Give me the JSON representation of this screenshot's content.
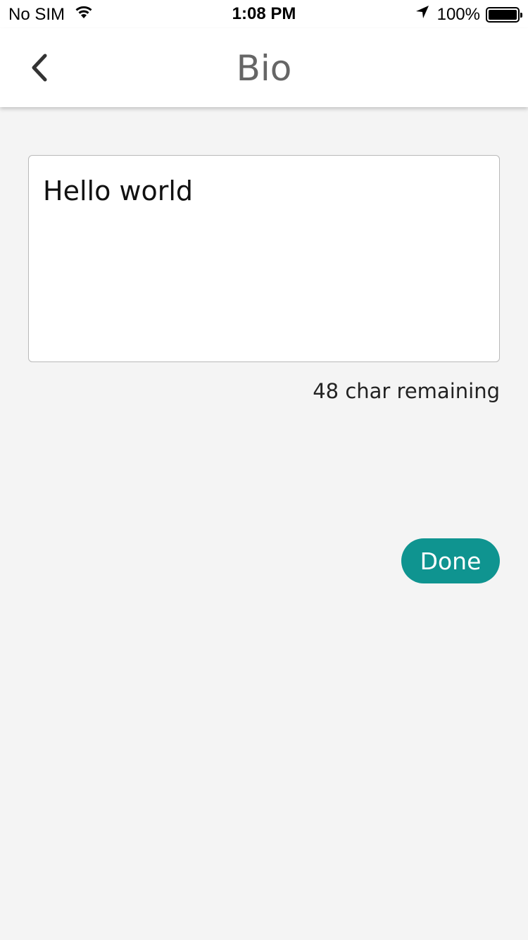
{
  "status_bar": {
    "carrier": "No SIM",
    "time": "1:08 PM",
    "battery": "100%",
    "battery_level": 1.0
  },
  "nav": {
    "title": "Bio",
    "back_icon": "chevron-left-icon"
  },
  "bio": {
    "text": "Hello world",
    "remaining_label": "48 char remaining"
  },
  "actions": {
    "done_label": "Done"
  },
  "colors": {
    "accent": "#0f9490",
    "background": "#f4f4f4",
    "title": "#666666"
  }
}
